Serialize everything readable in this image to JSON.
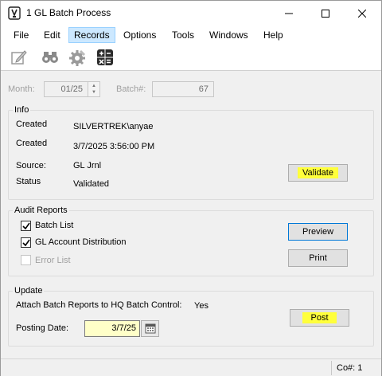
{
  "window": {
    "title": "1 GL Batch Process"
  },
  "menu": [
    "File",
    "Edit",
    "Records",
    "Options",
    "Tools",
    "Windows",
    "Help"
  ],
  "menu_active_index": 2,
  "toolbar": [
    "edit-icon",
    "binoculars-icon",
    "settings-gear-icon",
    "calculator-icon"
  ],
  "header": {
    "month_label": "Month:",
    "month_value": "01/25",
    "batch_label": "Batch#:",
    "batch_value": "67"
  },
  "info": {
    "title": "Info",
    "created_label_1": "Created",
    "created_by": "SILVERTREK\\anyae",
    "created_label_2": "Created",
    "created_on": "3/7/2025 3:56:00 PM",
    "source_label": "Source:",
    "source_value": "GL Jrnl",
    "status_label": "Status",
    "status_value": "Validated",
    "validate_button": "Validate"
  },
  "audit": {
    "title": "Audit Reports",
    "batch_list": "Batch List",
    "gl_account_distribution": "GL Account Distribution",
    "error_list": "Error List",
    "preview_button": "Preview",
    "print_button": "Print",
    "checked": {
      "batch_list": true,
      "gl_account_distribution": true,
      "error_list": false
    }
  },
  "update": {
    "title": "Update",
    "attach_label": "Attach Batch Reports to HQ Batch Control:",
    "attach_value": "Yes",
    "posting_date_label": "Posting Date:",
    "posting_date_value": "3/7/25",
    "post_button": "Post"
  },
  "status_bar": {
    "company": "Co#: 1"
  },
  "colors": {
    "highlight": "#ffff3b",
    "menu_active": "#cce8ff",
    "date_field": "#ffffc8"
  }
}
